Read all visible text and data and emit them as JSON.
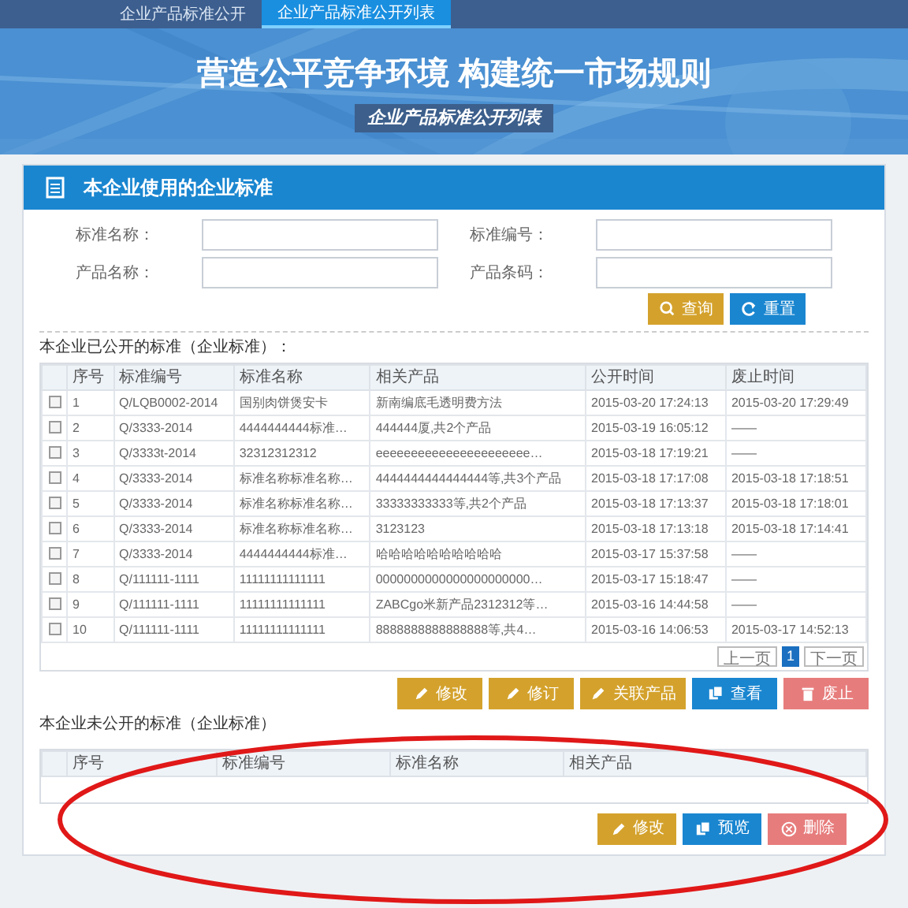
{
  "nav_tabs": [
    {
      "label": "企业产品标准公开",
      "selected": false
    },
    {
      "label": "企业产品标准公开列表",
      "selected": true
    }
  ],
  "banner": {
    "title": "营造公平竞争环境 构建统一市场规则",
    "subtitle": "企业产品标准公开列表"
  },
  "panel": {
    "title": "本企业使用的企业标准"
  },
  "search_form": {
    "fields": [
      {
        "label": "标准名称："
      },
      {
        "label": "标准编号："
      },
      {
        "label": "产品名称："
      },
      {
        "label": "产品条码："
      }
    ],
    "buttons": [
      {
        "kind": "search",
        "label": "查询"
      },
      {
        "kind": "reset",
        "label": "重置"
      }
    ]
  },
  "public_section": {
    "heading": "本企业已公开的标准（企业标准）：",
    "columns": [
      "序号",
      "标准编号",
      "标准名称",
      "相关产品",
      "公开时间",
      "废止时间"
    ],
    "rows": [
      {
        "checked": false,
        "cells": [
          "1",
          "Q/LQB0002-2014",
          "国别肉饼煲安卡",
          "新南编底毛透明费方法",
          "2015-03-20 17:24:13",
          "2015-03-20 17:29:49"
        ]
      },
      {
        "checked": false,
        "cells": [
          "2",
          "Q/3333-2014",
          "4444444444标准…",
          "444444厦,共2个产品",
          "2015-03-19 16:05:12",
          "——"
        ]
      },
      {
        "checked": false,
        "cells": [
          "3",
          "Q/3333t-2014",
          "32312312312",
          "eeeeeeeeeeeeeeeeeeeeee…",
          "2015-03-18 17:19:21",
          "——"
        ]
      },
      {
        "checked": false,
        "cells": [
          "4",
          "Q/3333-2014",
          "标准名称标准名称…",
          "4444444444444444等,共3个产品",
          "2015-03-18 17:17:08",
          "2015-03-18 17:18:51"
        ]
      },
      {
        "checked": false,
        "cells": [
          "5",
          "Q/3333-2014",
          "标准名称标准名称…",
          "33333333333等,共2个产品",
          "2015-03-18 17:13:37",
          "2015-03-18 17:18:01"
        ]
      },
      {
        "checked": false,
        "cells": [
          "6",
          "Q/3333-2014",
          "标准名称标准名称…",
          "3123123",
          "2015-03-18 17:13:18",
          "2015-03-18 17:14:41"
        ]
      },
      {
        "checked": false,
        "cells": [
          "7",
          "Q/3333-2014",
          "4444444444标准…",
          "哈哈哈哈哈哈哈哈哈哈",
          "2015-03-17 15:37:58",
          "——"
        ]
      },
      {
        "checked": false,
        "cells": [
          "8",
          "Q/111111-1111",
          "11111111111111",
          "0000000000000000000000…",
          "2015-03-17 15:18:47",
          "——"
        ]
      },
      {
        "checked": false,
        "cells": [
          "9",
          "Q/111111-1111",
          "11111111111111",
          "ZABCgo米新产品2312312等…",
          "2015-03-16 14:44:58",
          "——"
        ]
      },
      {
        "checked": false,
        "cells": [
          "10",
          "Q/111111-1111",
          "11111111111111",
          "8888888888888888等,共4…",
          "2015-03-16 14:06:53",
          "2015-03-17 14:52:13"
        ]
      }
    ],
    "pagination": [
      {
        "label": "上一页",
        "selected": false
      },
      {
        "label": "1",
        "selected": true
      },
      {
        "label": "下一页",
        "selected": false
      }
    ],
    "buttons": [
      {
        "kind": "edit",
        "label": "修改"
      },
      {
        "kind": "edit",
        "label": "修订"
      },
      {
        "kind": "edit",
        "label": "关联产品"
      },
      {
        "kind": "view",
        "label": "查看"
      },
      {
        "kind": "delete",
        "label": "废止"
      }
    ]
  },
  "private_section": {
    "heading": "本企业未公开的标准（企业标准）",
    "columns": [
      "序号",
      "标准编号",
      "标准名称",
      "相关产品"
    ],
    "buttons": [
      {
        "kind": "edit",
        "label": "修改"
      },
      {
        "kind": "view",
        "label": "预览"
      },
      {
        "kind": "remove",
        "label": "删除"
      }
    ]
  },
  "annotations": [
    {
      "kind": "ellipse"
    }
  ]
}
